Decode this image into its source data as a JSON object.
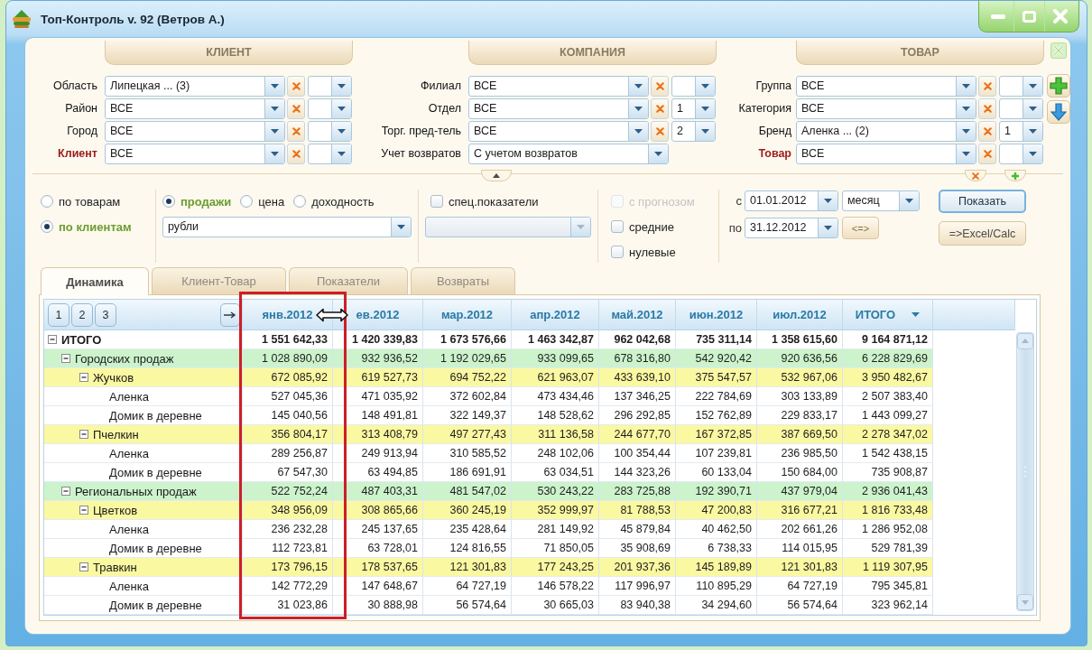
{
  "window": {
    "title": "Топ-Контроль v. 92 (Ветров А.)"
  },
  "filter_groups": [
    {
      "title": "КЛИЕНТ",
      "fields": [
        {
          "kind": "filter",
          "label": "Область",
          "highlighted": false,
          "value": "Липецкая ... (3)"
        },
        {
          "kind": "filter",
          "label": "Район",
          "highlighted": false,
          "value": "ВСЕ"
        },
        {
          "kind": "filter",
          "label": "Город",
          "highlighted": false,
          "value": "ВСЕ"
        },
        {
          "kind": "filter",
          "label": "Клиент",
          "highlighted": true,
          "value": "ВСЕ"
        }
      ]
    },
    {
      "title": "КОМПАНИЯ",
      "fields": [
        {
          "kind": "filter",
          "label": "Филиал",
          "highlighted": false,
          "value": "ВСЕ"
        },
        {
          "kind": "filter",
          "label": "Отдел",
          "highlighted": false,
          "value": "ВСЕ",
          "order": "1"
        },
        {
          "kind": "filter",
          "label": "Торг. пред-тель",
          "highlighted": false,
          "value": "ВСЕ",
          "order": "2"
        },
        {
          "kind": "select",
          "label": "Учет возвратов",
          "highlighted": false,
          "value": "С учетом возвратов"
        }
      ]
    },
    {
      "title": "ТОВАР",
      "fields": [
        {
          "kind": "filter",
          "label": "Группа",
          "highlighted": false,
          "value": "ВСЕ"
        },
        {
          "kind": "filter",
          "label": "Категория",
          "highlighted": false,
          "value": "ВСЕ"
        },
        {
          "kind": "filter",
          "label": "Бренд",
          "highlighted": false,
          "value": "Аленка ... (2)",
          "order": "1"
        },
        {
          "kind": "filter",
          "label": "Товар",
          "highlighted": true,
          "value": "ВСЕ"
        }
      ]
    }
  ],
  "view_by": [
    {
      "label": "по товарам",
      "selected": false
    },
    {
      "label": "по клиентам",
      "selected": true
    }
  ],
  "measure": {
    "options": [
      {
        "label": "продажи",
        "selected": true
      },
      {
        "label": "цена",
        "selected": false
      },
      {
        "label": "доходность",
        "selected": false
      }
    ],
    "unit": "рубли"
  },
  "special": {
    "label": "спец.показатели",
    "checked": false,
    "select_disabled": true
  },
  "extras": [
    {
      "label": "с прогнозом",
      "checked": false,
      "disabled": true
    },
    {
      "label": "средние",
      "checked": false,
      "disabled": false
    },
    {
      "label": "нулевые",
      "checked": false,
      "disabled": false
    }
  ],
  "period": {
    "from_label": "с",
    "from": "01.01.2012",
    "step": "месяц",
    "to_label": "по",
    "to": "31.12.2012",
    "swap": "<=>"
  },
  "actions": [
    {
      "label": "Показать",
      "default": true
    },
    {
      "label": "=>Excel/Calc",
      "default": false
    }
  ],
  "tabs": [
    {
      "label": "Динамика",
      "selected": true
    },
    {
      "label": "Клиент-Товар",
      "selected": false
    },
    {
      "label": "Показатели",
      "selected": false
    },
    {
      "label": "Возвраты",
      "selected": false
    }
  ],
  "table": {
    "levels": [
      "1",
      "2",
      "3"
    ],
    "columns": [
      {
        "label": "янв.2012",
        "highlighted": true,
        "menu": false
      },
      {
        "label": "ев.2012",
        "highlighted": false,
        "menu": false
      },
      {
        "label": "мар.2012",
        "highlighted": false,
        "menu": false
      },
      {
        "label": "апр.2012",
        "highlighted": false,
        "menu": false
      },
      {
        "label": "май.2012",
        "highlighted": false,
        "menu": false
      },
      {
        "label": "июн.2012",
        "highlighted": false,
        "menu": false
      },
      {
        "label": "июл.2012",
        "highlighted": false,
        "menu": false
      },
      {
        "label": "ИТОГО",
        "highlighted": false,
        "menu": true
      }
    ],
    "rows": [
      {
        "label": "ИТОГО",
        "expanded": true,
        "values": [
          "1 551 642,33",
          "1 420 339,83",
          "1 673 576,66",
          "1 463 342,87",
          "962 042,68",
          "735 311,14",
          "1 358 615,60",
          "9 164 871,12"
        ],
        "children": [
          {
            "label": "Городских продаж",
            "expanded": true,
            "values": [
              "1 028 890,09",
              "932 936,52",
              "1 192 029,65",
              "933 099,65",
              "678 316,80",
              "542 920,42",
              "920 636,56",
              "6 228 829,69"
            ],
            "children": [
              {
                "label": "Жучков",
                "expanded": true,
                "values": [
                  "672 085,92",
                  "619 527,73",
                  "694 752,22",
                  "621 963,07",
                  "433 639,10",
                  "375 547,57",
                  "532 967,06",
                  "3 950 482,67"
                ],
                "children": [
                  {
                    "label": "Аленка",
                    "values": [
                      "527 045,36",
                      "471 035,92",
                      "372 602,84",
                      "473 434,46",
                      "137 346,25",
                      "222 784,69",
                      "303 133,89",
                      "2 507 383,40"
                    ]
                  },
                  {
                    "label": "Домик в деревне",
                    "values": [
                      "145 040,56",
                      "148 491,81",
                      "322 149,37",
                      "148 528,62",
                      "296 292,85",
                      "152 762,89",
                      "229 833,17",
                      "1 443 099,27"
                    ]
                  }
                ]
              },
              {
                "label": "Пчелкин",
                "expanded": true,
                "values": [
                  "356 804,17",
                  "313 408,79",
                  "497 277,43",
                  "311 136,58",
                  "244 677,70",
                  "167 372,85",
                  "387 669,50",
                  "2 278 347,02"
                ],
                "children": [
                  {
                    "label": "Аленка",
                    "values": [
                      "289 256,87",
                      "249 913,94",
                      "310 585,52",
                      "248 102,06",
                      "100 354,44",
                      "107 239,81",
                      "236 985,50",
                      "1 542 438,15"
                    ]
                  },
                  {
                    "label": "Домик в деревне",
                    "values": [
                      "67 547,30",
                      "63 494,85",
                      "186 691,91",
                      "63 034,51",
                      "144 323,26",
                      "60 133,04",
                      "150 684,00",
                      "735 908,87"
                    ]
                  }
                ]
              }
            ]
          },
          {
            "label": "Региональных продаж",
            "expanded": true,
            "values": [
              "522 752,24",
              "487 403,31",
              "481 547,02",
              "530 243,22",
              "283 725,88",
              "192 390,71",
              "437 979,04",
              "2 936 041,43"
            ],
            "children": [
              {
                "label": "Цветков",
                "expanded": true,
                "values": [
                  "348 956,09",
                  "308 865,66",
                  "360 245,19",
                  "352 999,97",
                  "81 788,53",
                  "47 200,83",
                  "316 677,21",
                  "1 816 733,48"
                ],
                "children": [
                  {
                    "label": "Аленка",
                    "values": [
                      "236 232,28",
                      "245 137,65",
                      "235 428,64",
                      "281 149,92",
                      "45 879,84",
                      "40 462,50",
                      "202 661,26",
                      "1 286 952,08"
                    ]
                  },
                  {
                    "label": "Домик в деревне",
                    "values": [
                      "112 723,81",
                      "63 728,01",
                      "124 816,55",
                      "71 850,05",
                      "35 908,69",
                      "6 738,33",
                      "114 015,95",
                      "529 781,39"
                    ]
                  }
                ]
              },
              {
                "label": "Травкин",
                "expanded": true,
                "values": [
                  "173 796,15",
                  "178 537,65",
                  "121 301,83",
                  "177 243,25",
                  "201 937,36",
                  "145 189,89",
                  "121 301,83",
                  "1 119 307,95"
                ],
                "children": [
                  {
                    "label": "Аленка",
                    "values": [
                      "142 772,29",
                      "147 648,67",
                      "64 727,19",
                      "146 578,22",
                      "117 996,97",
                      "110 895,29",
                      "64 727,19",
                      "795 345,81"
                    ]
                  },
                  {
                    "label": "Домик в деревне",
                    "values": [
                      "31 023,86",
                      "30 888,98",
                      "56 574,64",
                      "30 665,03",
                      "83 940,38",
                      "34 294,60",
                      "56 574,64",
                      "323 962,14"
                    ]
                  }
                ]
              }
            ]
          }
        ]
      }
    ]
  }
}
